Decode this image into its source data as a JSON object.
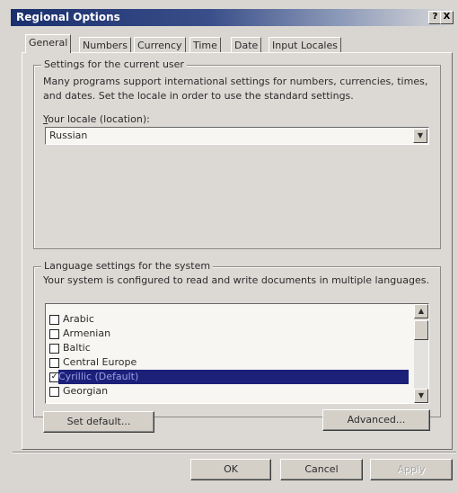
{
  "window": {
    "title": "Regional Options",
    "help_label": "?",
    "close_label": "X"
  },
  "tabs": [
    {
      "label": "General",
      "active": true
    },
    {
      "label": "Numbers",
      "active": false
    },
    {
      "label": "Currency",
      "active": false
    },
    {
      "label": "Time",
      "active": false
    },
    {
      "label": "Date",
      "active": false
    },
    {
      "label": "Input Locales",
      "active": false
    }
  ],
  "user_settings": {
    "legend": "Settings for the current user",
    "description_line1": "Many programs support international settings for numbers, currencies, times,",
    "description_line2": "and dates. Set the locale in order to use the standard settings.",
    "locale_label": "Your locale (location):",
    "locale_value": "Russian"
  },
  "system_settings": {
    "legend": "Language settings for the system",
    "description": "Your system is configured to read and write documents in multiple languages.",
    "languages": [
      {
        "label": "Arabic",
        "checked": false,
        "selected": false
      },
      {
        "label": "Armenian",
        "checked": false,
        "selected": false
      },
      {
        "label": "Baltic",
        "checked": false,
        "selected": false
      },
      {
        "label": "Central Europe",
        "checked": false,
        "selected": false
      },
      {
        "label": "Cyrillic   (Default)",
        "checked": true,
        "selected": true
      },
      {
        "label": "Georgian",
        "checked": false,
        "selected": false
      }
    ],
    "set_default_label": "Set default...",
    "advanced_label": "Advanced..."
  },
  "footer": {
    "ok_label": "OK",
    "cancel_label": "Cancel",
    "apply_label": "Apply"
  },
  "colors": {
    "titlebar": "#1a2f6d",
    "selection": "#1c2079",
    "face": "#d4d0c8"
  }
}
